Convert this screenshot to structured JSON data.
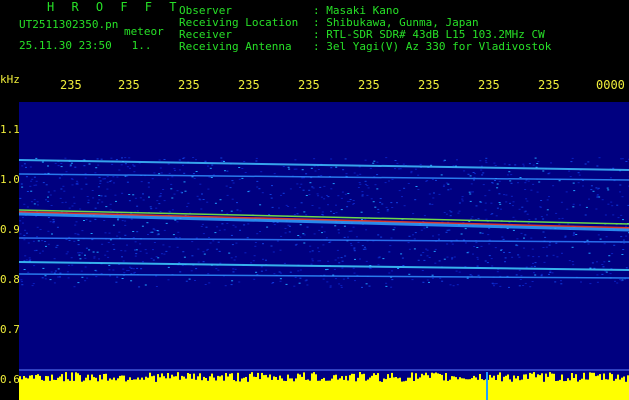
{
  "header": {
    "title": "H R O F F T",
    "filename": "UT2511302350.pn",
    "tag": "meteor",
    "timestamp": "25.11.30 23:50   1..",
    "labels": {
      "observer": "Observer",
      "location": "Receiving Location",
      "receiver": "Receiver",
      "antenna": "Receiving Antenna"
    },
    "values": {
      "observer": ": Masaki Kano",
      "location": ": Shibukawa, Gunma, Japan",
      "receiver": ": RTL-SDR SDR# 43dB L15 103.2MHz CW",
      "antenna": ": 3el Yagi(V) Az 330 for Vladivostok"
    }
  },
  "axis": {
    "y_unit": "kHz",
    "y_ticks": [
      "1.1",
      "1.0",
      "0.9",
      "0.8",
      "0.7",
      "0.6"
    ],
    "x_ticks": [
      "235",
      "235",
      "235",
      "235",
      "235",
      "235",
      "235",
      "235",
      "235",
      "0000"
    ]
  },
  "colors": {
    "text_green": "#27e027",
    "text_yellow": "#f0ee3a",
    "background": "#000000",
    "spectrum_bg": "#000080",
    "signal_hot": "#ff3020",
    "noise_band": "#ffff00"
  }
}
